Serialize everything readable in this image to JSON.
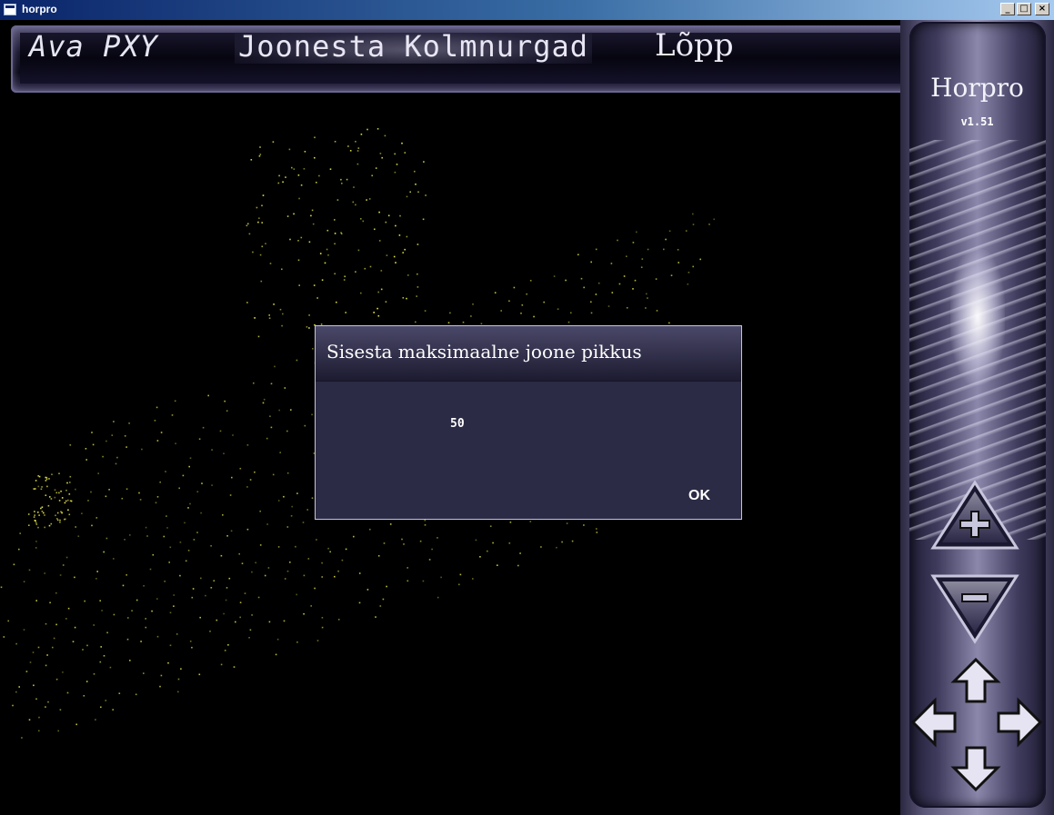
{
  "window": {
    "title": "horpro",
    "minimize_label": "_",
    "maximize_label": "□",
    "close_label": "×"
  },
  "menu": {
    "items": [
      {
        "label": "Ava PXY"
      },
      {
        "label": "Joonesta Kolmnurgad"
      },
      {
        "label": "Lõpp"
      }
    ]
  },
  "sidebar": {
    "app_name": "Horpro",
    "version": "v1.51",
    "buttons": [
      "zoom-in-icon",
      "zoom-out-icon",
      "arrow-up-icon",
      "arrow-left-icon",
      "arrow-right-icon",
      "arrow-down-icon"
    ]
  },
  "dialog": {
    "title": "Sisesta maksimaalne joone pikkus",
    "value": "50",
    "ok_label": "OK"
  },
  "colors": {
    "background": "#000000",
    "points": "#e8e84a",
    "dialog_body": "#2c2b45",
    "chrome": "#5a5678"
  }
}
